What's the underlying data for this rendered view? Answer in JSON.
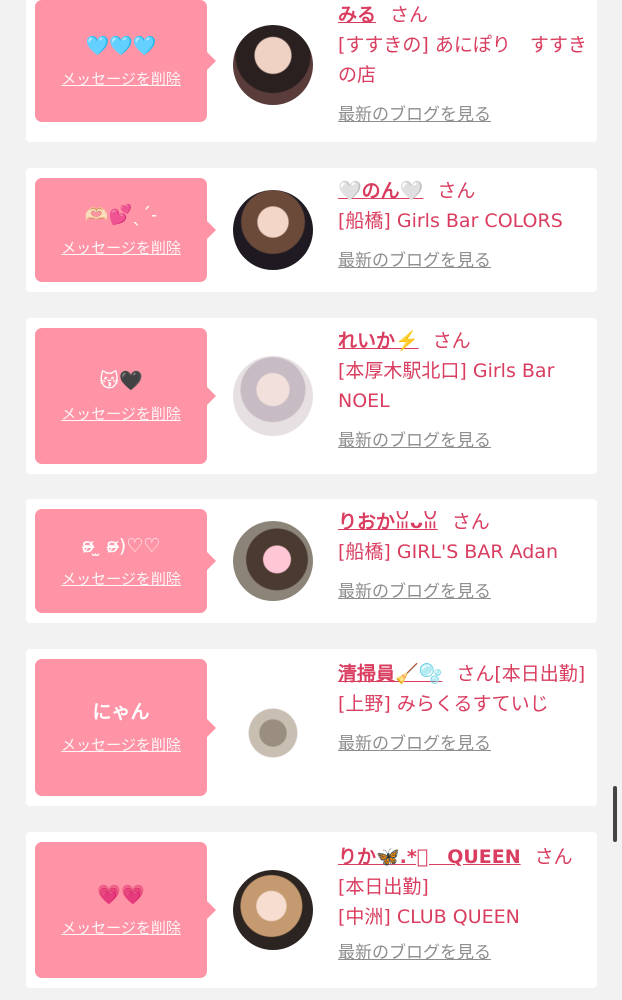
{
  "delete_label": "メッセージを削除",
  "blog_label": "最新のブログを見る",
  "honorific": "さん",
  "entries": [
    {
      "message": "🩵🩵🩵",
      "name": "みる",
      "status": "",
      "shop": "[すすきの] あにぽり　すすきの店"
    },
    {
      "message": "🫶🏻💕ˎˊ˗",
      "name": "🤍のん🤍",
      "status": "",
      "shop": "[船橋] Girls Bar COLORS"
    },
    {
      "message": "😽🖤",
      "name": "れいか⚡️",
      "status": "",
      "shop": "[本厚木駅北口] Girls Bar NOEL"
    },
    {
      "message": "ʚ̴̶̷ ̫ ʚ̴̶̷)♡♡",
      "name": "りおかꈍᴗꈍ",
      "status": "",
      "shop": "[船橋] GIRL'S BAR Adan"
    },
    {
      "message": "にゃん",
      "name": "清掃員🧹🫧",
      "status": "[本日出勤]",
      "shop": "[上野] みらくるすていじ"
    },
    {
      "message": "💗💗",
      "name": "りか🦋.*ﾟ　QUEEN",
      "status": "[本日出勤]",
      "shop": "[中洲] CLUB QUEEN"
    }
  ]
}
